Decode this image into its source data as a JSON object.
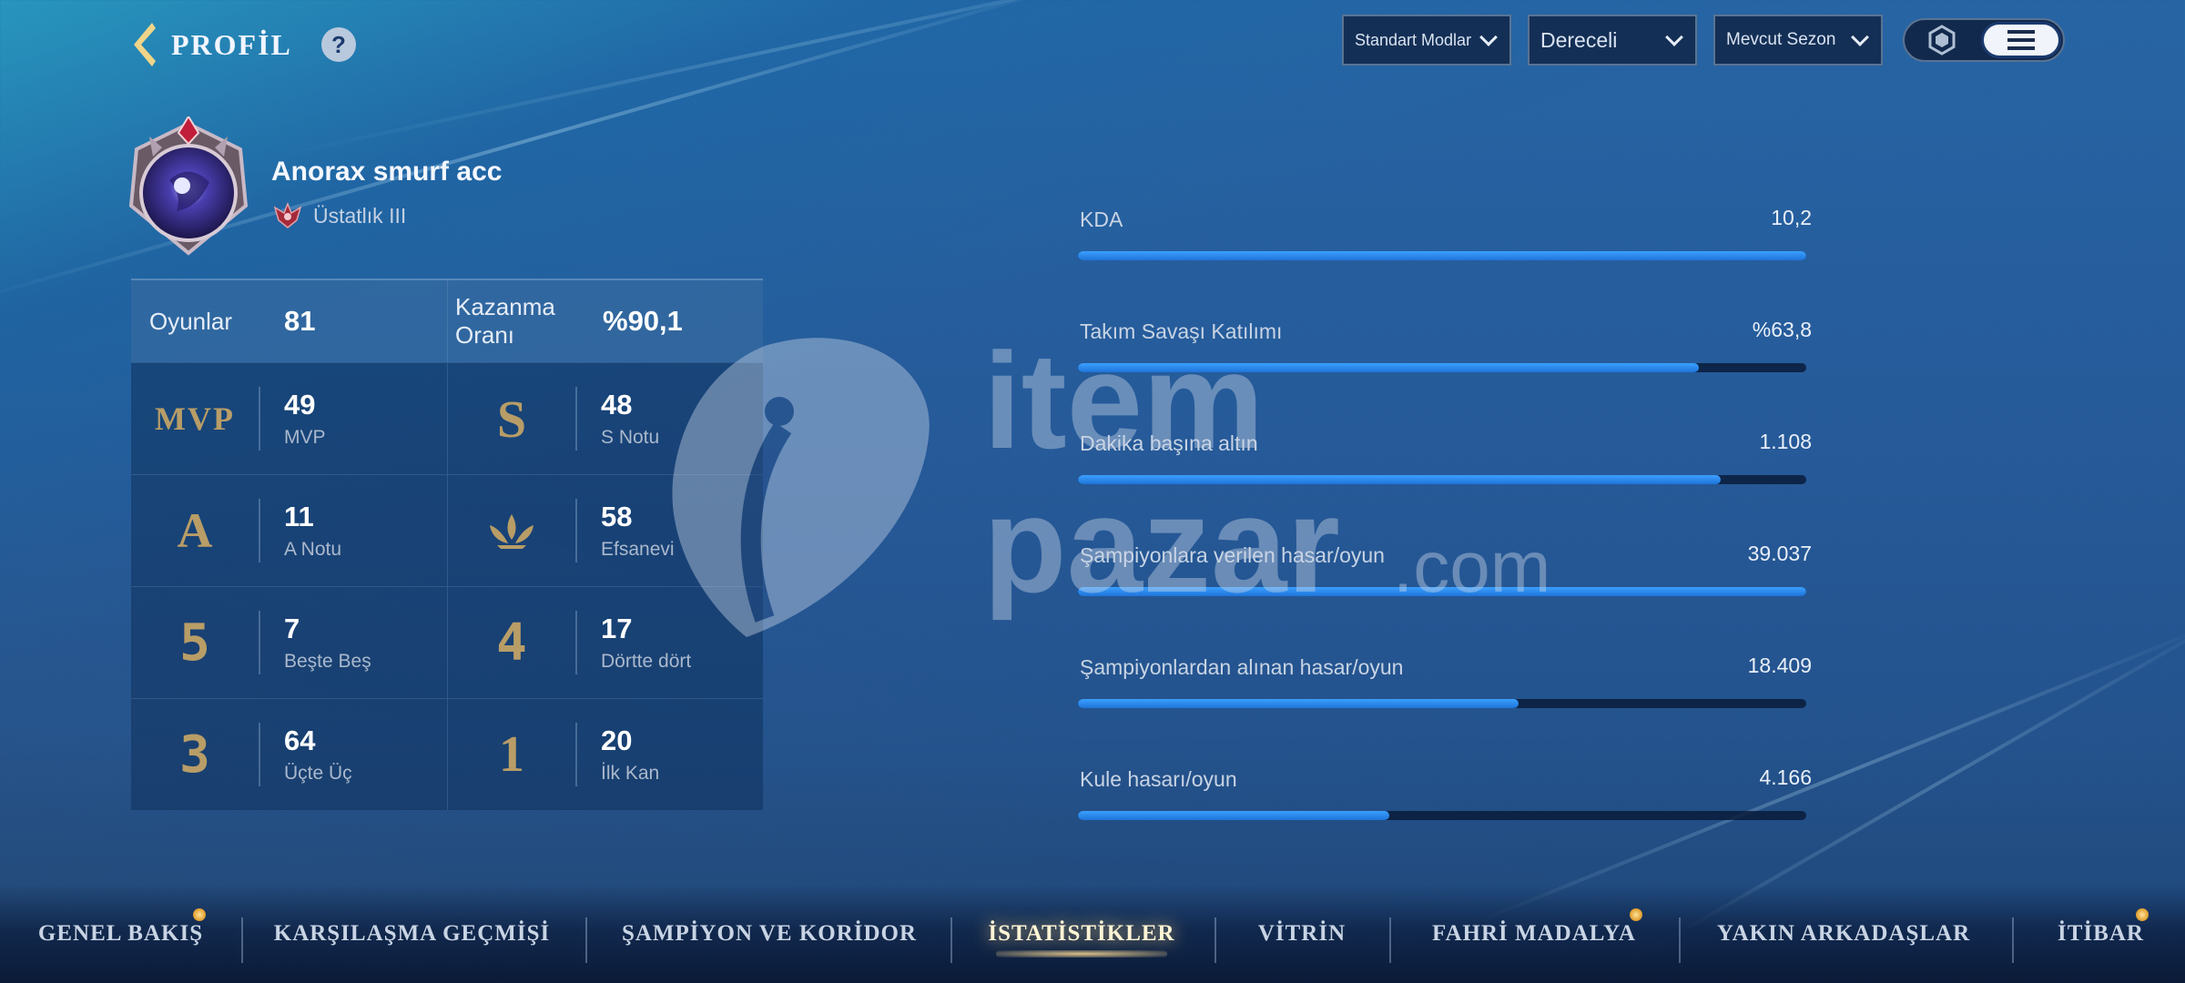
{
  "header": {
    "title": "PROFİL",
    "help_label": "?"
  },
  "filters": [
    {
      "label": "Standart Modlar"
    },
    {
      "label": "Dereceli"
    },
    {
      "label": "Mevcut Sezon"
    }
  ],
  "view_toggle": {
    "options": [
      "hexagon-icon",
      "list-icon"
    ],
    "selected": "list-icon"
  },
  "profile": {
    "name": "Anorax smurf acc",
    "rank": "Üstatlık III"
  },
  "summary": {
    "games_label": "Oyunlar",
    "games_value": "81",
    "winrate_label": "Kazanma Oranı",
    "winrate_value": "%90,1"
  },
  "stats": [
    {
      "badge": "MVP",
      "value": "49",
      "label": "MVP"
    },
    {
      "badge": "S",
      "value": "48",
      "label": "S Notu"
    },
    {
      "badge": "A",
      "value": "11",
      "label": "A Notu"
    },
    {
      "badge": "legendary-emblem-icon",
      "value": "58",
      "label": "Efsanevi"
    },
    {
      "badge": "5",
      "value": "7",
      "label": "Beşte Beş"
    },
    {
      "badge": "4",
      "value": "17",
      "label": "Dörtte dört"
    },
    {
      "badge": "3",
      "value": "64",
      "label": "Üçte Üç"
    },
    {
      "badge": "1",
      "value": "20",
      "label": "İlk Kan"
    }
  ],
  "metrics": [
    {
      "label": "KDA",
      "value": "10,2",
      "fill": 1.0
    },
    {
      "label": "Takım Savaşı Katılımı",
      "value": "%63,8",
      "fill": 0.853
    },
    {
      "label": "Dakika başına altın",
      "value": "1.108",
      "fill": 0.882
    },
    {
      "label": "Şampiyonlara verilen hasar/oyun",
      "value": "39.037",
      "fill": 1.0
    },
    {
      "label": "Şampiyonlardan alınan hasar/oyun",
      "value": "18.409",
      "fill": 0.605
    },
    {
      "label": "Kule hasarı/oyun",
      "value": "4.166",
      "fill": 0.428
    }
  ],
  "watermark": {
    "line1": "item",
    "line2": "pazar",
    "suffix": ".com"
  },
  "tabs": [
    {
      "label": "GENEL BAKIŞ",
      "notify": true,
      "active": false
    },
    {
      "label": "KARŞILAŞMA GEÇMİŞİ",
      "notify": false,
      "active": false
    },
    {
      "label": "ŞAMPİYON VE KORİDOR",
      "notify": false,
      "active": false
    },
    {
      "label": "İSTATİSTİKLER",
      "notify": false,
      "active": true
    },
    {
      "label": "VİTRİN",
      "notify": false,
      "active": false
    },
    {
      "label": "FAHRİ MADALYA",
      "notify": true,
      "active": false
    },
    {
      "label": "YAKIN ARKADAŞLAR",
      "notify": false,
      "active": false
    },
    {
      "label": "İTİBAR",
      "notify": true,
      "active": false
    }
  ],
  "colors": {
    "accent_bar": "#2a8cf0",
    "badge_gold": "#b89d67",
    "active_tab_glow": "#ffdc96",
    "notify_dot": "#e3a537"
  }
}
